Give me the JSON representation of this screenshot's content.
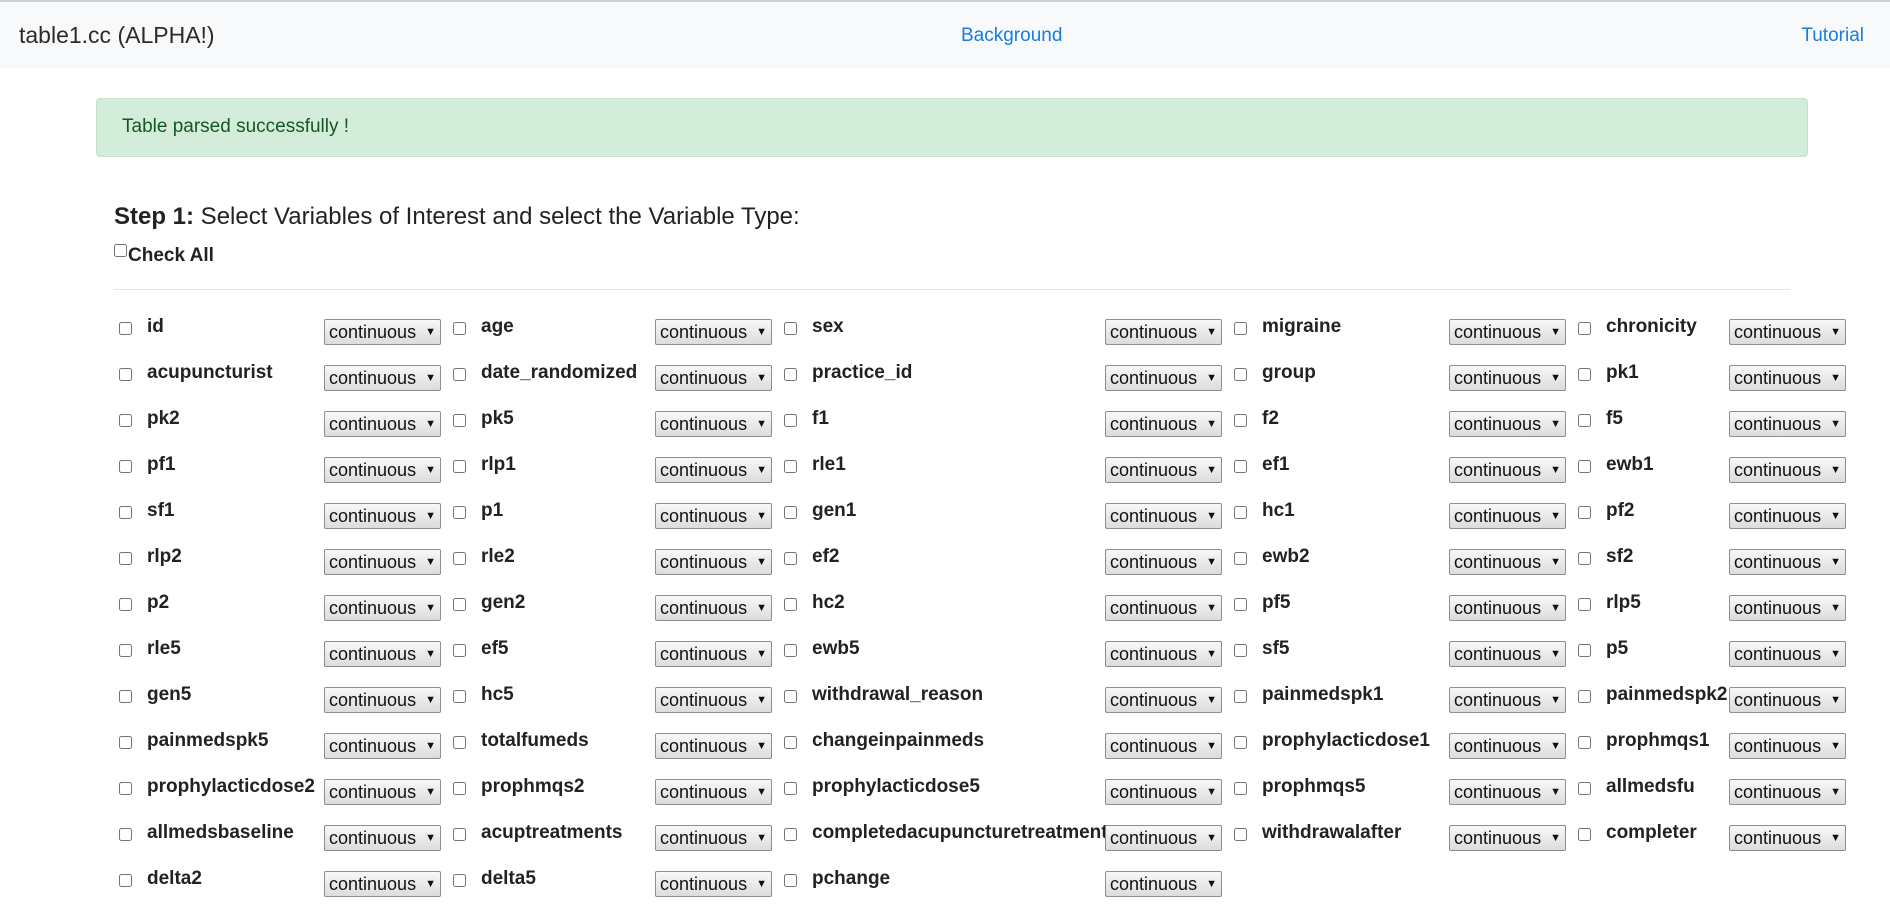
{
  "nav": {
    "brand": "table1.cc (ALPHA!)",
    "links": [
      "Background",
      "Tutorial"
    ]
  },
  "alert": {
    "message": "Table parsed successfully !"
  },
  "step1": {
    "label": "Step 1:",
    "text": " Select Variables of Interest and select the Variable Type:",
    "check_all": "Check All"
  },
  "type_default": "continuous",
  "variables": [
    "id",
    "age",
    "sex",
    "migraine",
    "chronicity",
    "acupuncturist",
    "date_randomized",
    "practice_id",
    "group",
    "pk1",
    "pk2",
    "pk5",
    "f1",
    "f2",
    "f5",
    "pf1",
    "rlp1",
    "rle1",
    "ef1",
    "ewb1",
    "sf1",
    "p1",
    "gen1",
    "hc1",
    "pf2",
    "rlp2",
    "rle2",
    "ef2",
    "ewb2",
    "sf2",
    "p2",
    "gen2",
    "hc2",
    "pf5",
    "rlp5",
    "rle5",
    "ef5",
    "ewb5",
    "sf5",
    "p5",
    "gen5",
    "hc5",
    "withdrawal_reason",
    "painmedspk1",
    "painmedspk2",
    "painmedspk5",
    "totalfumeds",
    "changeinpainmeds",
    "prophylacticdose1",
    "prophmqs1",
    "prophylacticdose2",
    "prophmqs2",
    "prophylacticdose5",
    "prophmqs5",
    "allmedsfu",
    "allmedsbaseline",
    "acuptreatments",
    "completedacupuncturetreatment",
    "withdrawalafter",
    "completer",
    "delta2",
    "delta5",
    "pchange"
  ],
  "colors": {
    "alert_bg": "#d4edda",
    "alert_text": "#155724",
    "link": "#1a7be0",
    "navbar_bg": "#f8f9fa"
  }
}
